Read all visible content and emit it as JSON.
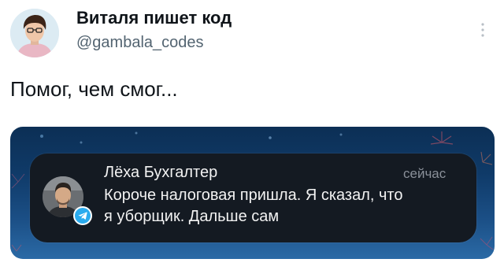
{
  "tweet": {
    "author": {
      "display_name": "Виталя пишет код",
      "handle": "@gambala_codes"
    },
    "text": "Помог, чем смог..."
  },
  "notification": {
    "app_icon": "telegram-icon",
    "sender": "Лёха Бухгалтер",
    "time": "сейчас",
    "message_lines": [
      "Короче налоговая пришла. Я сказал, что",
      "я уборщик. Дальше сам"
    ]
  },
  "colors": {
    "telegram_blue": "#2aabee",
    "notification_bg": "#141a22",
    "wallpaper_dark": "#0c2f55",
    "wallpaper_light": "#2b6aa6"
  }
}
